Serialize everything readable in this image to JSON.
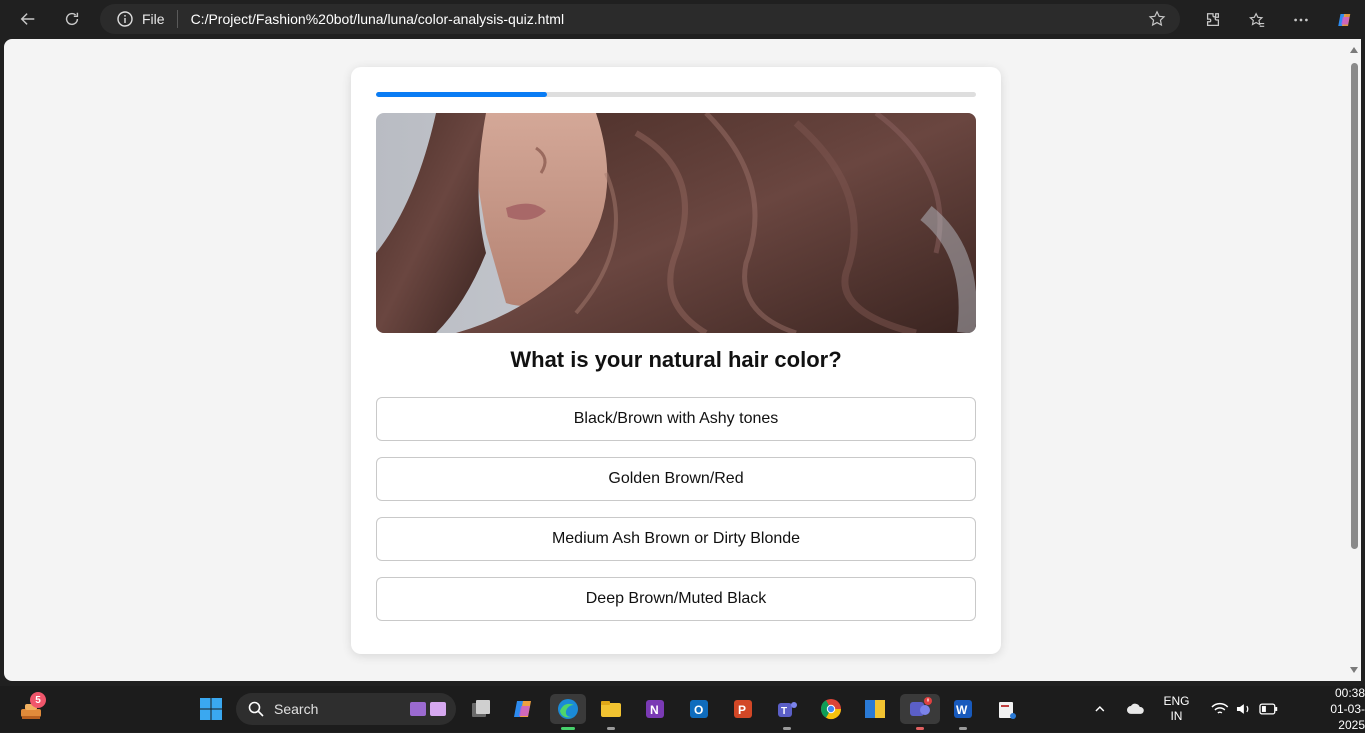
{
  "browser": {
    "file_label": "File",
    "url": "C:/Project/Fashion%20bot/luna/luna/color-analysis-quiz.html"
  },
  "quiz": {
    "progress": 0.285,
    "question": "What is your natural hair color?",
    "options": [
      "Black/Brown with Ashy tones",
      "Golden Brown/Red",
      "Medium Ash Brown or Dirty Blonde",
      "Deep Brown/Muted Black"
    ],
    "accent_color": "#0a7cf4"
  },
  "taskbar": {
    "search_placeholder": "Search",
    "notification_badge": "5",
    "language_line1": "ENG",
    "language_line2": "IN",
    "time": "00:38",
    "date": "01-03-2025"
  }
}
